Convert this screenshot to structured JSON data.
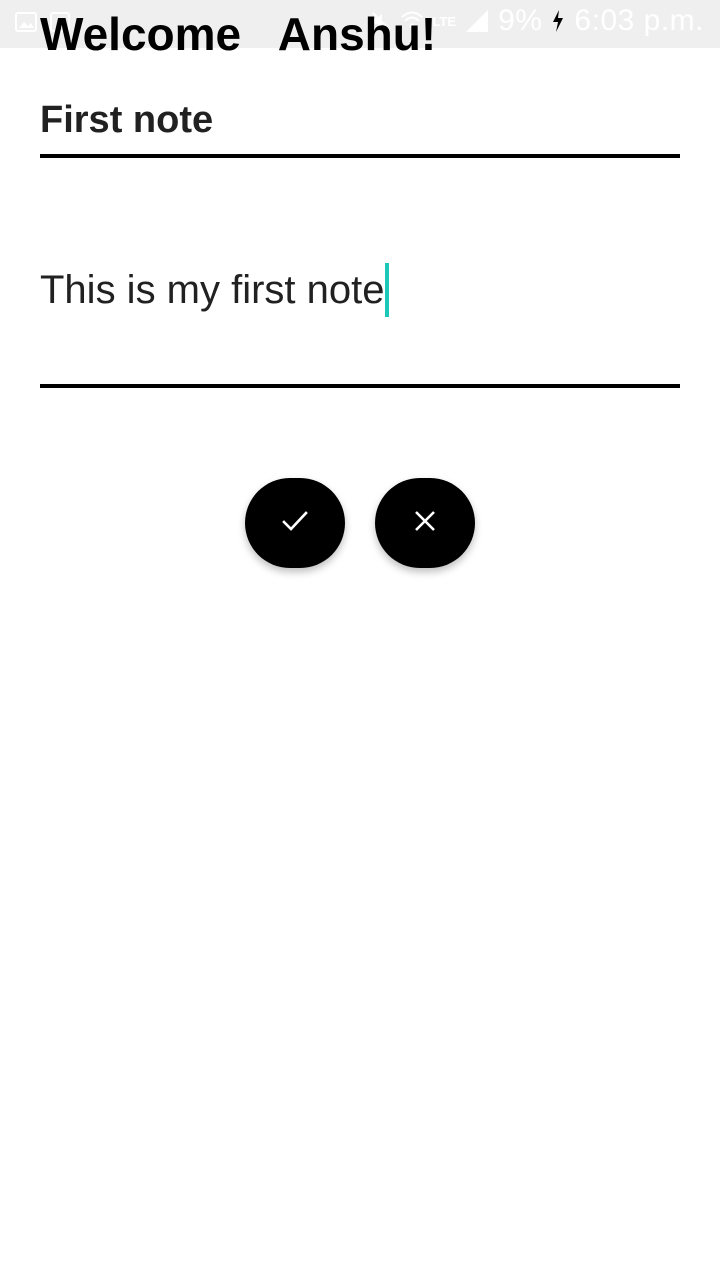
{
  "status_bar": {
    "network": "LTE",
    "battery": "9%",
    "time": "6:03 p.m."
  },
  "header": {
    "welcome_text": "Welcome   Anshu!"
  },
  "note": {
    "title": "First note",
    "body": "This is my first note"
  },
  "actions": {
    "confirm_icon": "check-icon",
    "cancel_icon": "close-icon"
  },
  "colors": {
    "accent_cursor": "#1cc9b9",
    "button_bg": "#000000",
    "underline": "#000000"
  }
}
